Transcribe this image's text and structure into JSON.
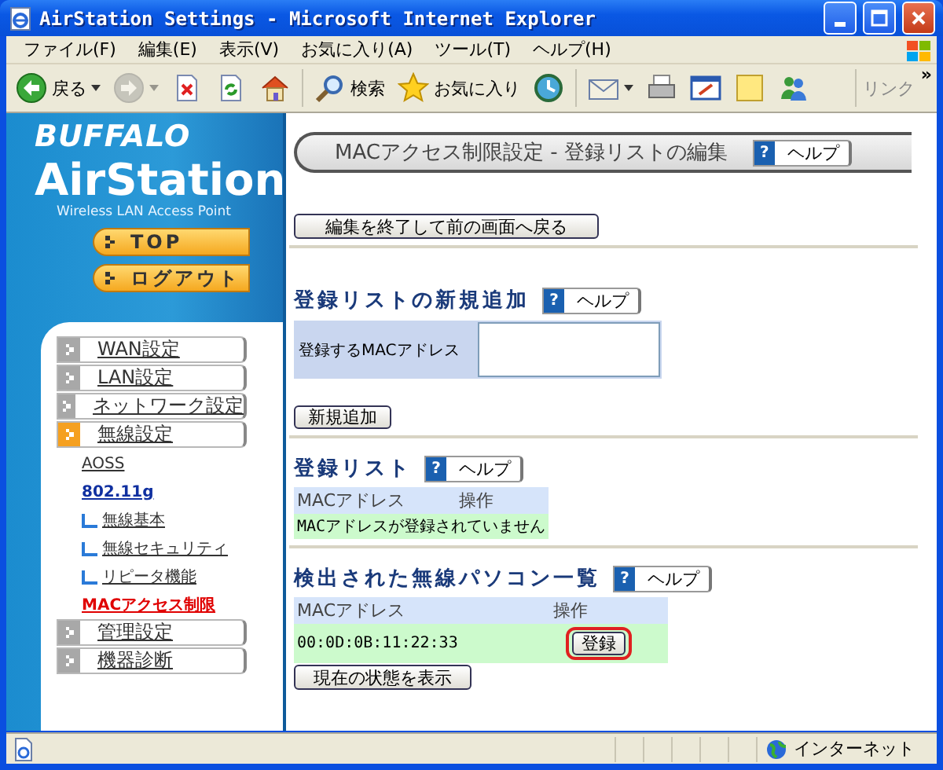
{
  "window": {
    "title": "AirStation Settings - Microsoft Internet Explorer"
  },
  "menu_bar": [
    "ファイル(F)",
    "編集(E)",
    "表示(V)",
    "お気に入り(A)",
    "ツール(T)",
    "ヘルプ(H)"
  ],
  "toolbar": [
    {
      "kind": "back",
      "label": "戻る",
      "dropdown": true,
      "disabled": false
    },
    {
      "kind": "forward",
      "dropdown": true,
      "disabled": true
    },
    {
      "kind": "stop",
      "dropdown": false,
      "disabled": false
    },
    {
      "kind": "refresh",
      "dropdown": false,
      "disabled": false
    },
    {
      "kind": "home",
      "dropdown": false,
      "disabled": false
    },
    {
      "kind": "search",
      "label": "検索",
      "dropdown": false,
      "disabled": false
    },
    {
      "kind": "favorites",
      "label": "お気に入り",
      "dropdown": false,
      "disabled": false
    },
    {
      "kind": "history",
      "dropdown": false,
      "disabled": false
    },
    {
      "kind": "mail",
      "dropdown": true,
      "disabled": false
    },
    {
      "kind": "print",
      "dropdown": false,
      "disabled": false
    },
    {
      "kind": "edit",
      "dropdown": false,
      "disabled": false
    },
    {
      "kind": "note",
      "dropdown": false,
      "disabled": false
    },
    {
      "kind": "messenger",
      "dropdown": false,
      "disabled": false
    }
  ],
  "links": {
    "label": "リンク",
    "chevron": "»"
  },
  "sidebar": {
    "brand": "BUFFALO",
    "product": "AirStation",
    "tagline": "Wireless LAN Access Point",
    "buttons": [
      "TOP",
      "ログアウト"
    ],
    "menu": [
      {
        "label": "WAN設定",
        "selected": false
      },
      {
        "label": "LAN設定",
        "selected": false
      },
      {
        "label": "ネットワーク設定",
        "selected": false
      },
      {
        "label": "無線設定",
        "selected": true,
        "children": [
          {
            "label": "AOSS",
            "selected": false
          },
          {
            "label": "802.11g",
            "selected": false,
            "children": [
              {
                "label": "無線基本",
                "selected": false
              },
              {
                "label": "無線セキュリティ",
                "selected": false
              },
              {
                "label": "リピータ機能",
                "selected": false
              }
            ]
          },
          {
            "label": "MACアクセス制限",
            "selected": true
          }
        ]
      },
      {
        "label": "管理設定",
        "selected": false
      },
      {
        "label": "機器診断",
        "selected": false
      }
    ]
  },
  "page": {
    "title": "MACアクセス制限設定 - 登録リストの編集",
    "help": {
      "mark": "?",
      "label": "ヘルプ"
    },
    "back_button": "編集を終了して前の画面へ戻る",
    "add_section": {
      "heading": "登録リストの新規追加",
      "help": {
        "mark": "?",
        "label": "ヘルプ"
      },
      "field_label": "登録するMACアドレス",
      "add_button": "新規追加"
    },
    "registered": {
      "heading": "登録リスト",
      "help": {
        "mark": "?",
        "label": "ヘルプ"
      },
      "columns": [
        "MACアドレス",
        "操作"
      ],
      "empty_message": "MACアドレスが登録されていません"
    },
    "detected": {
      "heading": "検出された無線パソコン一覧",
      "help": {
        "mark": "?",
        "label": "ヘルプ"
      },
      "columns": [
        "MACアドレス",
        "操作"
      ],
      "rows": [
        {
          "mac": "00:0D:0B:11:22:33",
          "action": "登録",
          "highlighted": true
        }
      ],
      "refresh_button": "現在の状態を表示"
    }
  },
  "status_bar": {
    "zone": "インターネット"
  }
}
